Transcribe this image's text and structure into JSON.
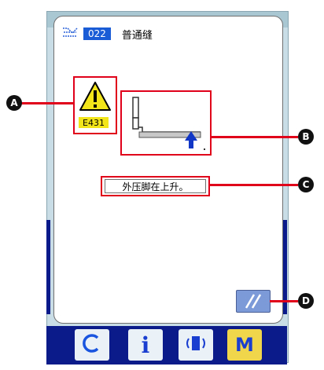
{
  "header": {
    "pattern_number": "022",
    "pattern_name": "普通缝"
  },
  "error": {
    "code": "E431",
    "message": "外压脚在上升。"
  },
  "callouts": {
    "a": "A",
    "b": "B",
    "c": "C",
    "d": "D"
  },
  "bottom_bar": {
    "info_label": "i",
    "mode_label": "M"
  },
  "colors": {
    "callout_red": "#e0001a",
    "bottom_bar_bg": "#0c1b8a",
    "number_badge_bg": "#1a5bd6",
    "warning_yellow": "#f2e51a",
    "arrow_blue": "#1237c7",
    "mode_button_bg": "#f0d64a"
  },
  "icons": {
    "pattern_type": "sewing-pattern-icon",
    "warning": "warning-triangle-icon",
    "reset": "reset-slash-icon",
    "thread": "thread-c-icon",
    "info": "info-icon",
    "communication": "communication-icon"
  }
}
